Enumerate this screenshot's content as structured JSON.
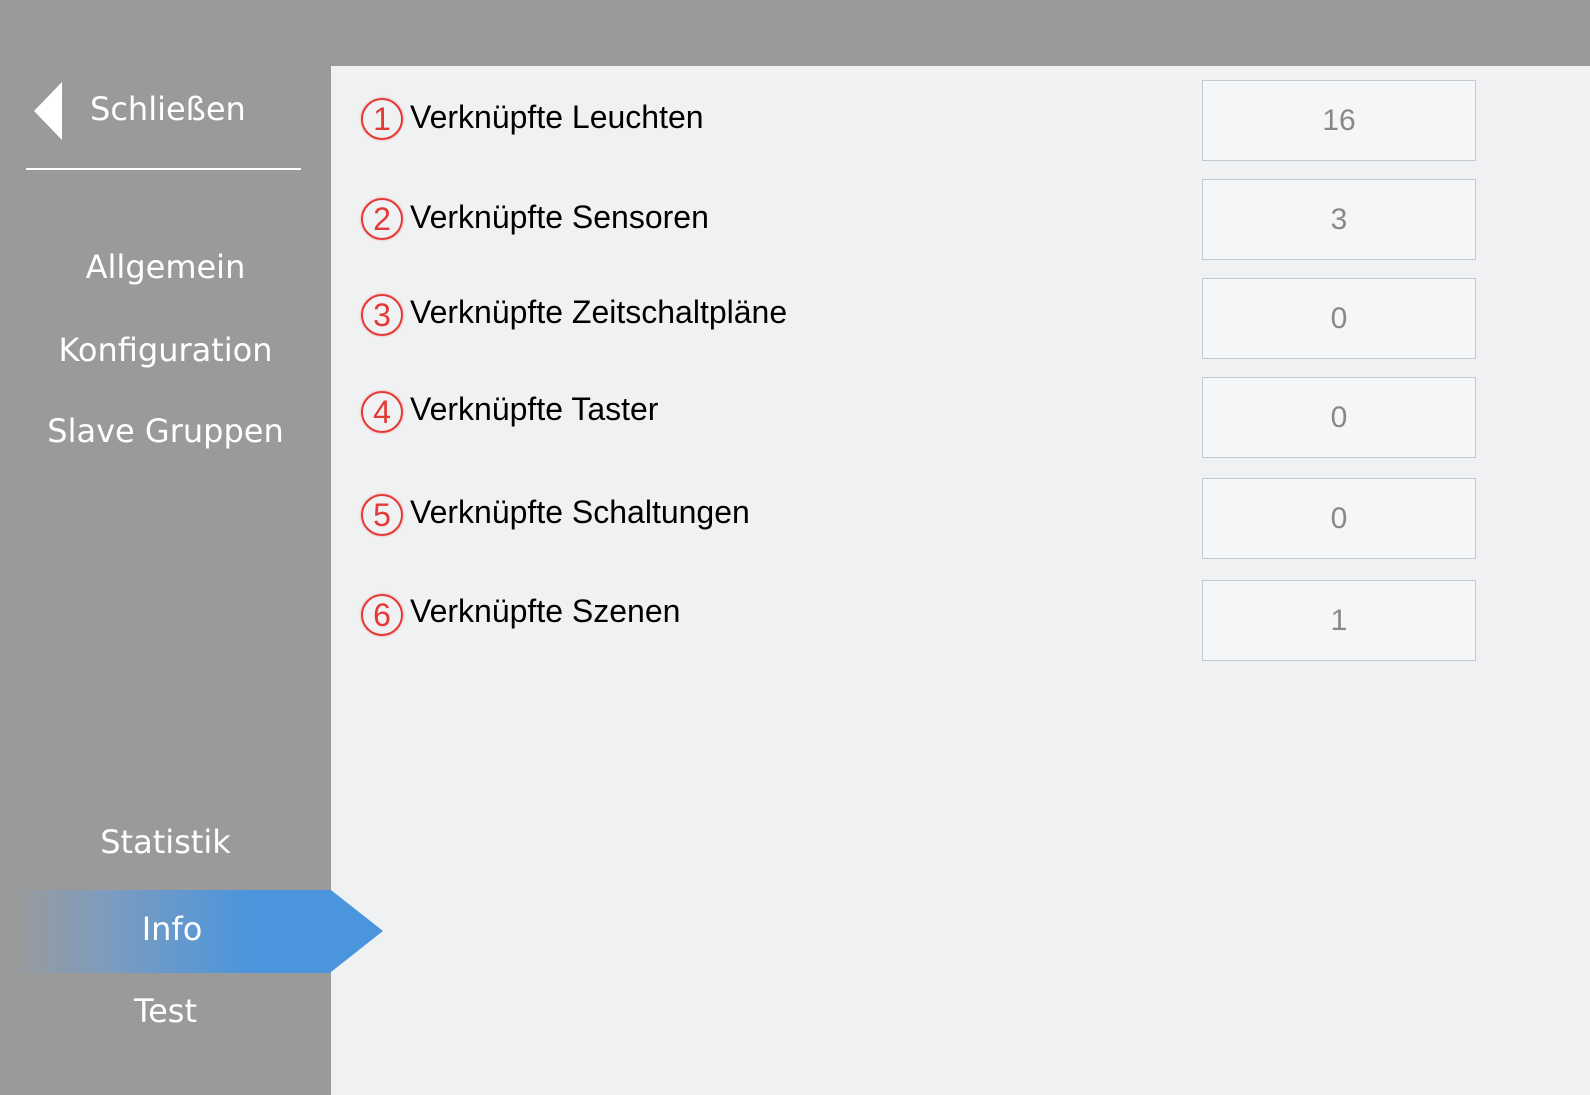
{
  "sidebar": {
    "close_label": "Schließen",
    "items": [
      {
        "label": "Allgemein"
      },
      {
        "label": "Konfiguration"
      },
      {
        "label": "Slave Gruppen"
      },
      {
        "label": "Statistik"
      },
      {
        "label": "Info"
      },
      {
        "label": "Test"
      }
    ],
    "active_item": "Info"
  },
  "info": {
    "rows": [
      {
        "badge": "1",
        "label": "Verknüpfte Leuchten",
        "value": "16"
      },
      {
        "badge": "2",
        "label": "Verknüpfte Sensoren",
        "value": "3"
      },
      {
        "badge": "3",
        "label": "Verknüpfte Zeitschaltpläne",
        "value": "0"
      },
      {
        "badge": "4",
        "label": "Verknüpfte Taster",
        "value": "0"
      },
      {
        "badge": "5",
        "label": "Verknüpfte Schaltungen",
        "value": "0"
      },
      {
        "badge": "6",
        "label": "Verknüpfte Szenen",
        "value": "1"
      }
    ]
  },
  "colors": {
    "sidebar_bg": "#9a9a9a",
    "content_bg": "#f0f1f3",
    "accent": "#4a95dc",
    "badge": "#e53935"
  }
}
